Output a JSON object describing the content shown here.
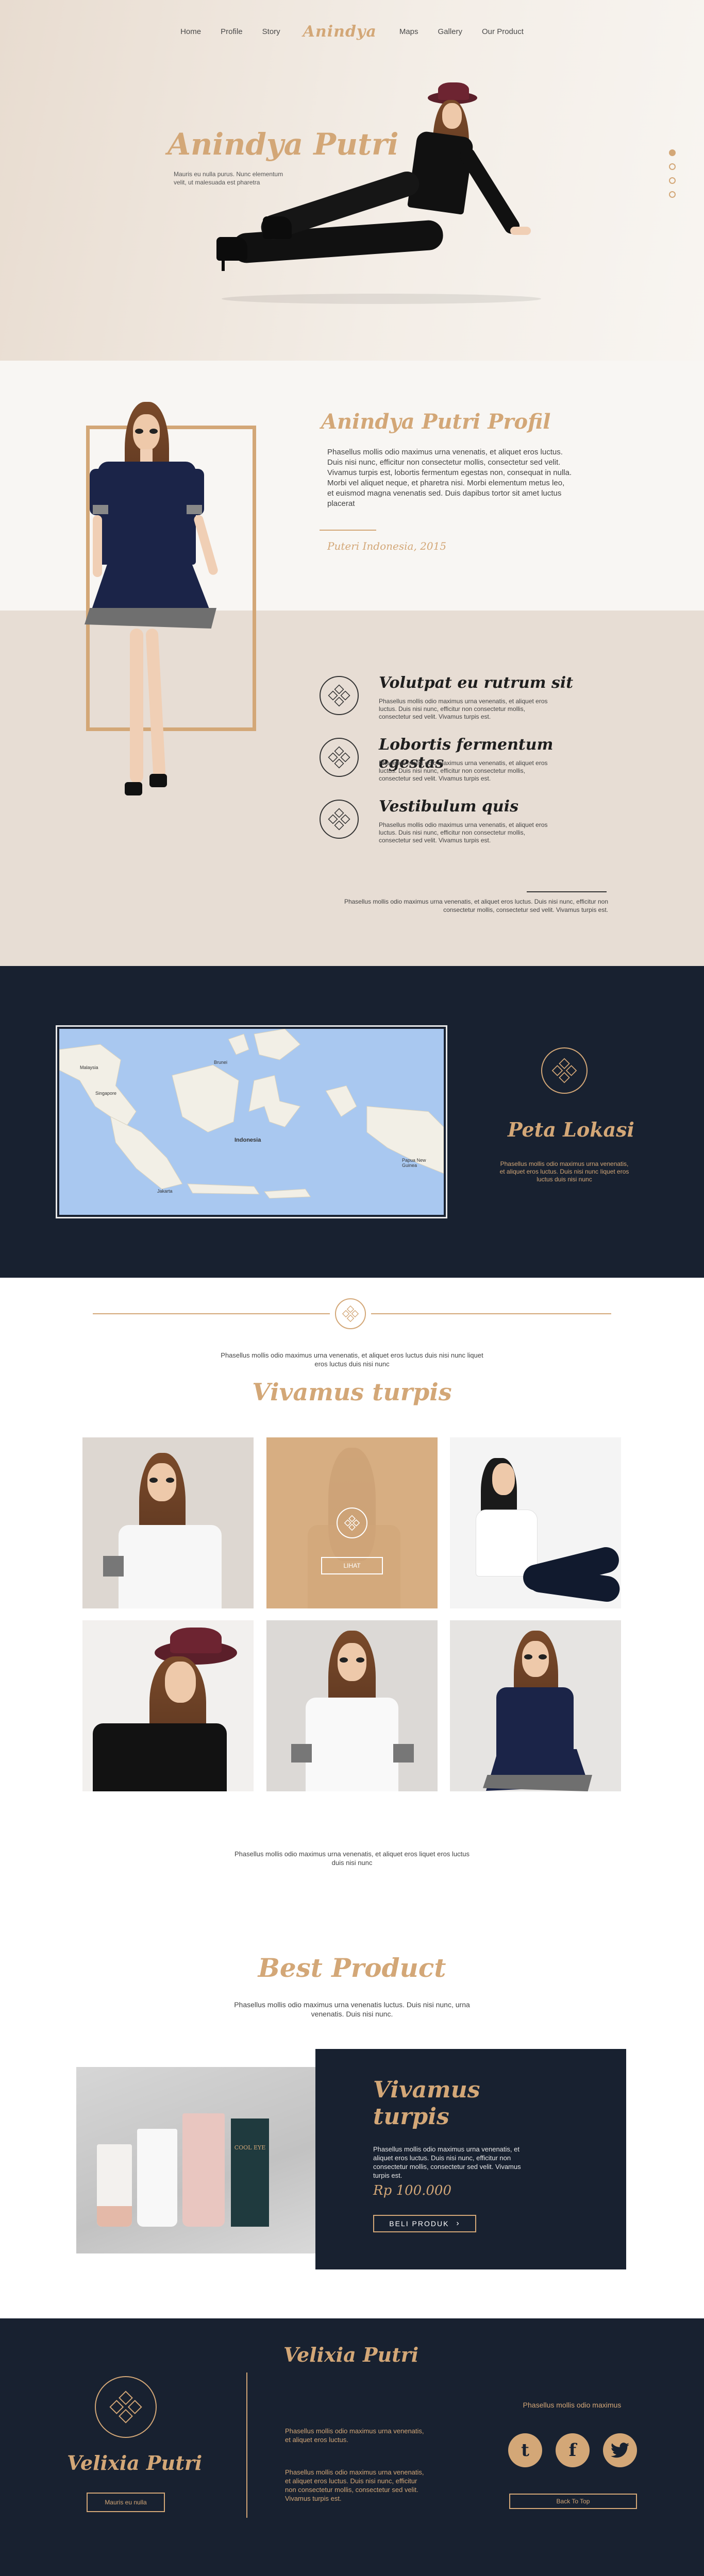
{
  "colors": {
    "accent": "#d3a777",
    "navy": "#182130",
    "beige": "#e7ddd4",
    "offwhite": "#f8f6f3"
  },
  "nav": {
    "items_left": [
      "Home",
      "Profile",
      "Story"
    ],
    "logo": "Anindya",
    "items_right": [
      "Maps",
      "Gallery",
      "Our Product"
    ]
  },
  "hero": {
    "title": "Anindya Putri",
    "text": "Mauris eu nulla purus. Nunc elementum velit, ut malesuada est pharetra",
    "active_slide": 1,
    "slide_count": 4
  },
  "profile": {
    "title": "Anindya Putri Profil",
    "text": "Phasellus mollis odio maximus urna venenatis, et aliquet eros luctus. Duis nisi nunc, efficitur non consectetur mollis, consectetur sed velit. Vivamus turpis est, lobortis fermentum egestas non, consequat in nulla. Morbi vel aliquet neque, et pharetra nisi. Morbi elementum metus leo, et euismod magna venenatis sed. Duis dapibus tortor sit amet luctus placerat",
    "caption": "Puteri Indonesia, 2015",
    "features": [
      {
        "title": "Volutpat eu rutrum sit",
        "text": "Phasellus mollis odio maximus urna venenatis, et aliquet eros luctus. Duis nisi nunc, efficitur non consectetur mollis, consectetur sed velit. Vivamus turpis est."
      },
      {
        "title": "Lobortis fermentum egestas",
        "text": "Phasellus mollis odio maximus urna venenatis, et aliquet eros luctus. Duis nisi nunc, efficitur non consectetur mollis, consectetur sed velit. Vivamus turpis est."
      },
      {
        "title": "Vestibulum quis",
        "text": "Phasellus mollis odio maximus urna venenatis, et aliquet eros luctus. Duis nisi nunc, efficitur non consectetur mollis, consectetur sed velit. Vivamus turpis est."
      }
    ],
    "bottom_text": "Phasellus mollis odio maximus urna venenatis, et aliquet eros luctus. Duis nisi nunc, efficitur non consectetur mollis, consectetur sed velit. Vivamus turpis est."
  },
  "map": {
    "title": "Peta Lokasi",
    "text": "Phasellus mollis odio maximus urna venenatis, et aliquet eros luctus. Duis nisi nunc Iiquet eros luctus duis nisi nunc",
    "labels": [
      "Singapore",
      "Malaysia",
      "Indonesia",
      "Jakarta",
      "Papua New Guinea",
      "Brunei"
    ]
  },
  "gallery": {
    "intro": "Phasellus mollis odio maximus urna venenatis, et aliquet eros luctus duis nisi nunc liquet eros luctus duis nisi nunc",
    "title": "Vivamus turpis",
    "hover_button": "LIHAT",
    "bottom_text": "Phasellus mollis odio maximus urna venenatis, et aliquet eros liquet eros luctus duis nisi nunc"
  },
  "best_product": {
    "title": "Best Product",
    "text": "Phasellus mollis odio maximus urna venenatis luctus. Duis nisi nunc, urna venenatis. Duis nisi nunc.",
    "card_title": "Vivamus turpis",
    "card_text": "Phasellus mollis odio maximus urna venenatis, et aliquet eros luctus. Duis nisi nunc, efficitur non consectetur mollis, consectetur sed velit. Vivamus turpis est.",
    "price": "Rp 100.000",
    "buy_label": "BELI PRODUK",
    "product_labels": [
      "COOL EYE"
    ]
  },
  "footer": {
    "name": "Velixia Putri",
    "left_button": "Mauris eu nulla",
    "mid_title": "Velixia Putri",
    "mid_text_1": "Phasellus mollis odio maximus urna venenatis, et aliquet eros luctus.",
    "mid_text_2": "Phasellus mollis odio maximus urna venenatis, et aliquet eros luctus. Duis nisi nunc, efficitur non consectetur mollis, consectetur sed velit. Vivamus turpis est.",
    "right_text": "Phasellus mollis odio maximus",
    "socials": [
      "tumblr-icon",
      "facebook-icon",
      "twitter-icon"
    ],
    "back_to_top": "Back To Top"
  }
}
